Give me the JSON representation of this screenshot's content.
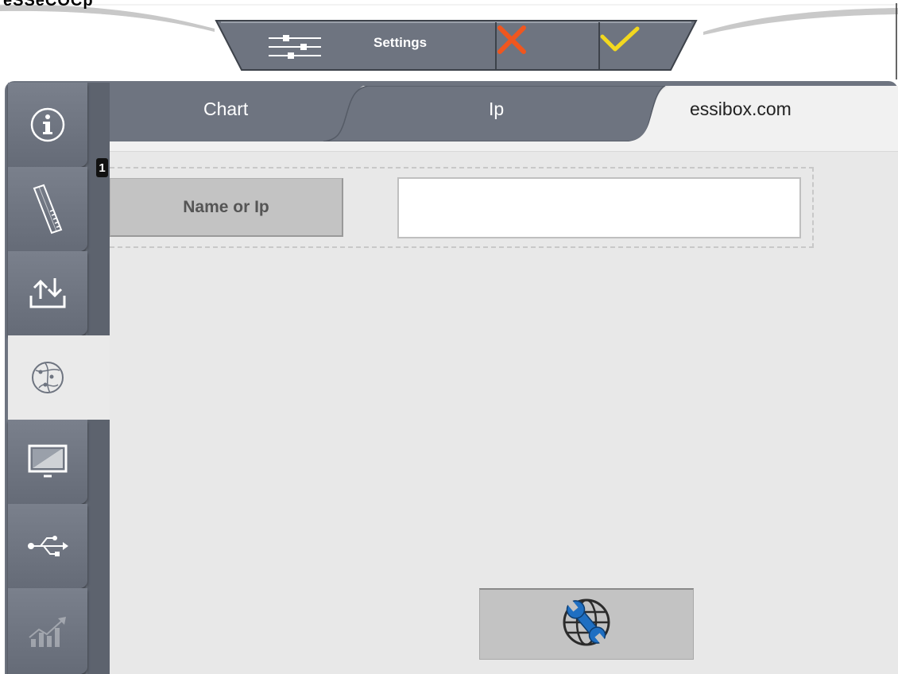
{
  "header": {
    "cut_text": "eSSeCOCp",
    "settings_label": "Settings",
    "icons": {
      "settings": "sliders-icon",
      "cancel": "close-icon",
      "confirm": "check-icon"
    },
    "colors": {
      "cancel": "#f0561e",
      "confirm": "#f2d81f",
      "bar": "#6e7480"
    }
  },
  "tabs": [
    {
      "label": "Chart",
      "active": false
    },
    {
      "label": "Ip",
      "active": false
    },
    {
      "label": "essibox.com",
      "active": true
    }
  ],
  "sidebar": {
    "items": [
      {
        "icon": "info-icon",
        "active": false
      },
      {
        "icon": "ruler-icon",
        "active": false
      },
      {
        "icon": "upload-download-icon",
        "active": false
      },
      {
        "icon": "network-globe-icon",
        "active": true
      },
      {
        "icon": "monitor-icon",
        "active": false
      },
      {
        "icon": "usb-icon",
        "active": false
      },
      {
        "icon": "chart-icon",
        "active": false,
        "disabled": true
      }
    ]
  },
  "settings": {
    "row_number": "1",
    "name_label": "Name or Ip",
    "name_value": "",
    "name_placeholder": ""
  },
  "actions": {
    "network_tool_icon": "globe-wrench-icon"
  }
}
